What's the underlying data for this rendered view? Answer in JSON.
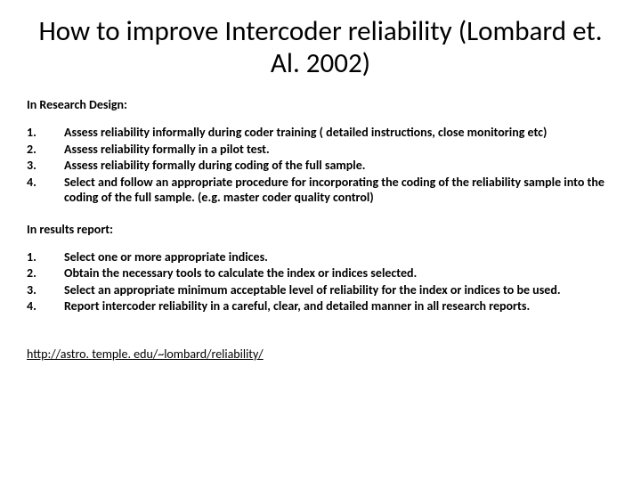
{
  "title": "How to improve Intercoder reliability (Lombard et. Al. 2002)",
  "section1": {
    "heading": "In Research Design:",
    "items": [
      {
        "n": "1.",
        "t": "Assess reliability informally during coder training ( detailed instructions, close monitoring etc)"
      },
      {
        "n": "2.",
        "t": "Assess reliability formally in a pilot test."
      },
      {
        "n": "3.",
        "t": "Assess reliability formally during coding of the full sample."
      },
      {
        "n": "4.",
        "t": "Select and follow an appropriate procedure for incorporating the coding of the reliability sample into the coding of the full sample. (e.g. master coder quality control)"
      }
    ]
  },
  "section2": {
    "heading": "In results report:",
    "items": [
      {
        "n": "1.",
        "t": "Select one or more appropriate indices."
      },
      {
        "n": "2.",
        "t": "Obtain the necessary tools to calculate the index or indices selected."
      },
      {
        "n": "3.",
        "t": "Select an appropriate minimum acceptable level of reliability for the index or indices to be used."
      },
      {
        "n": "4.",
        "t": "Report intercoder reliability in a careful, clear, and detailed manner in all research reports."
      }
    ]
  },
  "link": "http://astro. temple. edu/~lombard/reliability/"
}
